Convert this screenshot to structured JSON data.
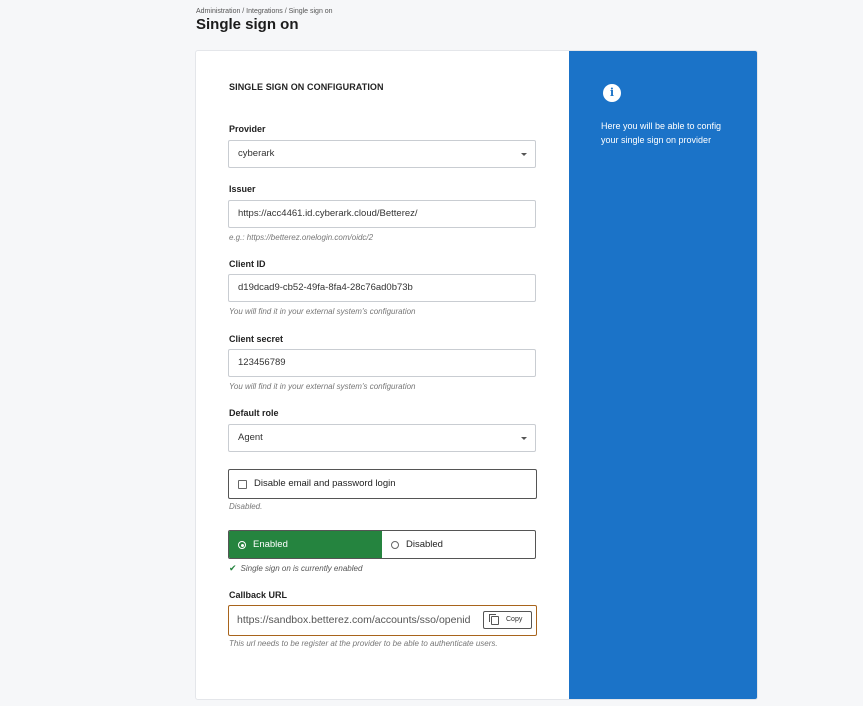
{
  "breadcrumb": "Administration / Integrations / Single sign on",
  "page_title": "Single sign on",
  "section_title": "SINGLE SIGN ON CONFIGURATION",
  "provider": {
    "label": "Provider",
    "value": "cyberark"
  },
  "issuer": {
    "label": "Issuer",
    "value": "https://acc4461.id.cyberark.cloud/Betterez/",
    "hint": "e.g.: https://betterez.onelogin.com/oidc/2"
  },
  "client_id": {
    "label": "Client ID",
    "value": "d19dcad9-cb52-49fa-8fa4-28c76ad0b73b",
    "hint": "You will find it in your external system's configuration"
  },
  "client_secret": {
    "label": "Client secret",
    "value": "123456789",
    "hint": "You will find it in your external system's configuration"
  },
  "default_role": {
    "label": "Default role",
    "value": "Agent"
  },
  "disable_login": {
    "label": "Disable email and password login",
    "checked": false,
    "hint": "Disabled."
  },
  "sso_toggle": {
    "enabled_label": "Enabled",
    "disabled_label": "Disabled",
    "selected": "Enabled",
    "status": "Single sign on is currently enabled"
  },
  "callback": {
    "label": "Callback URL",
    "value": "https://sandbox.betterez.com/accounts/sso/openid",
    "copy_label": "Copy",
    "hint": "This url needs to be register at the provider to be able to authenticate users."
  },
  "info_panel": {
    "icon": "info-icon",
    "text": "Here you will be able to config your single sign on provider"
  },
  "colors": {
    "accent": "#1b73c8",
    "enabled": "#25843f",
    "callback_border": "#a8641c"
  }
}
